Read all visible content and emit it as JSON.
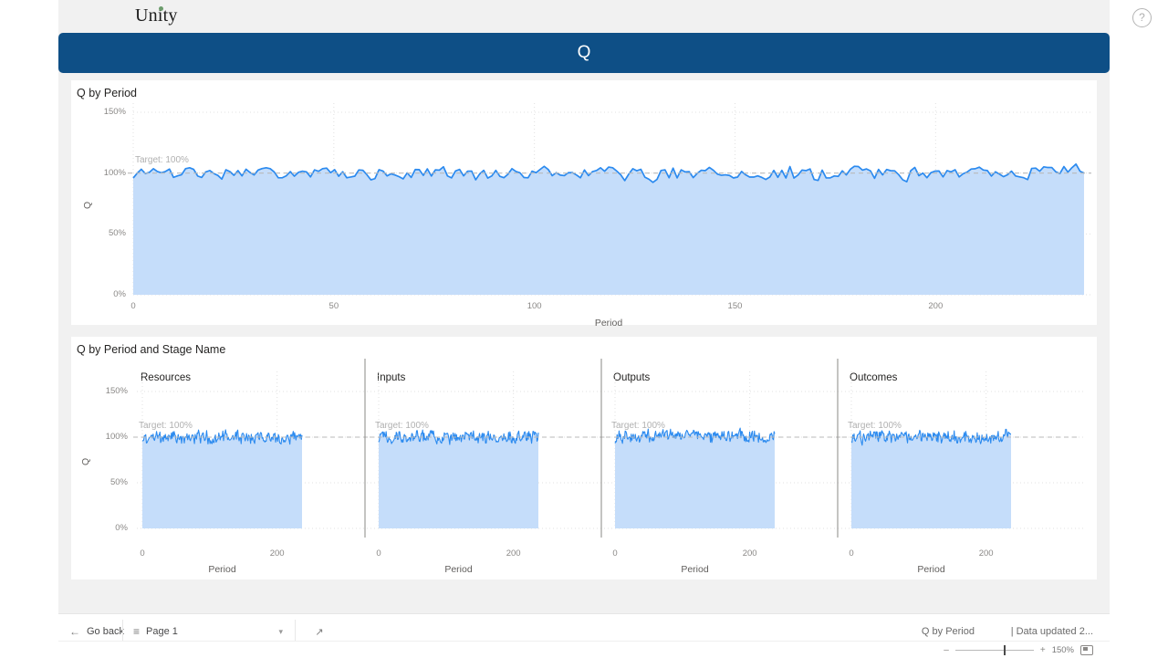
{
  "window": {
    "report_title": "Unity",
    "help_icon": "question-circle-icon"
  },
  "banner": {
    "text": "Q"
  },
  "cards": {
    "top": {
      "title": "Q by Period"
    },
    "bottom": {
      "title": "Q by Period and Stage Name"
    }
  },
  "footer": {
    "go_back_label": "Go back",
    "go_back_icon": "arrow-left-icon",
    "page_label": "Page 1",
    "page_icon": "pages-list-icon",
    "page_chevron": "chevron-down-icon",
    "focus_icon": "focus-mode-icon",
    "visual_name": "Q by Period",
    "data_updated": "| Data updated 2...",
    "zoom_minus": "–",
    "zoom_plus": "+",
    "zoom_value": "150%",
    "fit_icon": "fit-to-page-icon"
  },
  "chart_data": [
    {
      "id": "q-by-period",
      "type": "area",
      "title": "Q by Period",
      "xlabel": "Period",
      "ylabel": "Q",
      "xlim": [
        0,
        237
      ],
      "ylim": [
        0,
        1.5
      ],
      "xticks": [
        0,
        50,
        100,
        150,
        200
      ],
      "yticks": [
        "0%",
        "50%",
        "100%",
        "150%"
      ],
      "ytick_values": [
        0,
        0.5,
        1.0,
        1.5
      ],
      "grid": true,
      "legend": "none",
      "line_color": "#2b8aef",
      "fill_color": "#c5ddfa",
      "reference_line": {
        "label": "Target: 100%",
        "value": 1.0,
        "style": "dashed",
        "color": "#b9b9b9"
      },
      "series": [
        {
          "name": "Q",
          "mean": 1.0,
          "noise_amplitude": 0.075,
          "n_points": 237,
          "seed": 17
        }
      ]
    },
    {
      "id": "q-by-period-and-stage-name",
      "type": "area",
      "title": "Q by Period and Stage Name",
      "xlabel": "Period",
      "ylabel": "Q",
      "facet_by": "Stage Name",
      "ylim": [
        0,
        1.5
      ],
      "yticks": [
        "0%",
        "50%",
        "100%",
        "150%"
      ],
      "ytick_values": [
        0,
        0.5,
        1.0,
        1.5
      ],
      "xticks": [
        0,
        200
      ],
      "xlim": [
        0,
        237
      ],
      "grid": true,
      "legend": "none",
      "line_color": "#2b8aef",
      "fill_color": "#c5ddfa",
      "reference_line": {
        "label": "Target: 100%",
        "value": 1.0,
        "style": "dashed",
        "color": "#b9b9b9"
      },
      "facets": [
        {
          "name": "Resources",
          "mean": 1.0,
          "noise_amplitude": 0.085,
          "n_points": 237,
          "seed": 3
        },
        {
          "name": "Inputs",
          "mean": 1.0,
          "noise_amplitude": 0.085,
          "n_points": 237,
          "seed": 29
        },
        {
          "name": "Outputs",
          "mean": 1.01,
          "noise_amplitude": 0.085,
          "n_points": 237,
          "seed": 61
        },
        {
          "name": "Outcomes",
          "mean": 1.0,
          "noise_amplitude": 0.085,
          "n_points": 237,
          "seed": 97
        }
      ]
    }
  ]
}
